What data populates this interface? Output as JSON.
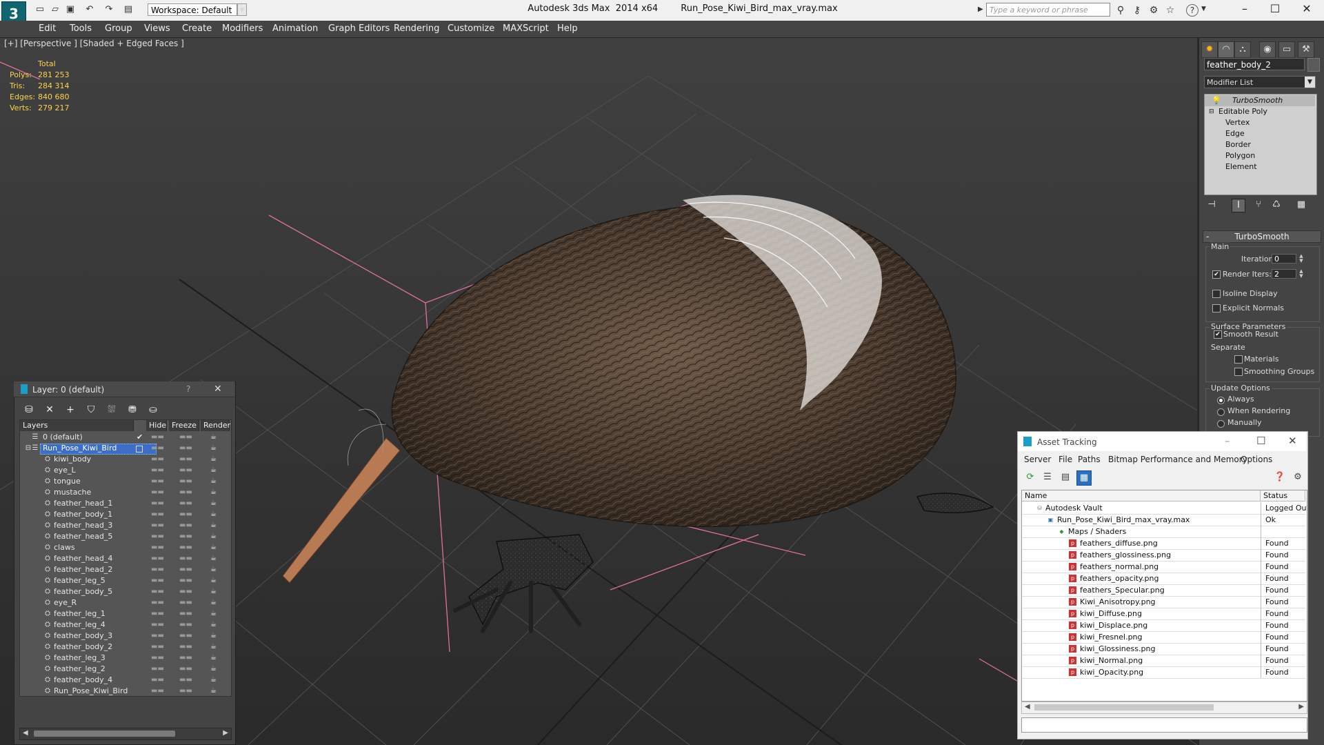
{
  "titlebar": {
    "workspace": "Workspace: Default",
    "app_name": "Autodesk 3ds Max  2014 x64",
    "file_name": "Run_Pose_Kiwi_Bird_max_vray.max",
    "search_placeholder": "Type a keyword or phrase",
    "help_label": "?",
    "minimize": "–",
    "maximize": "☐",
    "close": "✕"
  },
  "menu": [
    "Edit",
    "Tools",
    "Group",
    "Views",
    "Create",
    "Modifiers",
    "Animation",
    "Graph Editors",
    "Rendering",
    "Customize",
    "MAXScript",
    "Help"
  ],
  "viewport": {
    "label": "[+] [Perspective ] [Shaded + Edged Faces ]",
    "stats_header": "Total",
    "stats": [
      {
        "label": "Polys:",
        "value": "281 253"
      },
      {
        "label": "Tris:",
        "value": "284 314"
      },
      {
        "label": "Edges:",
        "value": "840 680"
      },
      {
        "label": "Verts:",
        "value": "279 217"
      }
    ]
  },
  "command_panel": {
    "object_name": "feather_body_2",
    "modifier_list": "Modifier List",
    "stack": {
      "turbosmooth": "TurboSmooth",
      "editable_poly": "Editable Poly",
      "subobjects": [
        "Vertex",
        "Edge",
        "Border",
        "Polygon",
        "Element"
      ]
    },
    "turbosmooth": {
      "title": "TurboSmooth",
      "main": "Main",
      "iterations_label": "Iterations:",
      "iterations_value": "0",
      "render_iters_label": "Render Iters:",
      "render_iters_value": "2",
      "isoline_display": "Isoline Display",
      "explicit_normals": "Explicit Normals",
      "surface_params": "Surface Parameters",
      "smooth_result": "Smooth Result",
      "separate": "Separate",
      "materials": "Materials",
      "smoothing_groups": "Smoothing Groups",
      "update_options": "Update Options",
      "always": "Always",
      "when_rendering": "When Rendering",
      "manually": "Manually"
    }
  },
  "layer_panel": {
    "title": "Layer: 0 (default)",
    "help": "?",
    "close": "✕",
    "columns": {
      "layers": "Layers",
      "hide": "Hide",
      "freeze": "Freeze",
      "render": "Render"
    },
    "layers": [
      "0 (default)",
      "Run_Pose_Kiwi_Bird",
      "kiwi_body",
      "eye_L",
      "tongue",
      "mustache",
      "feather_head_1",
      "feather_body_1",
      "feather_head_3",
      "feather_head_5",
      "claws",
      "feather_head_4",
      "feather_head_2",
      "feather_leg_5",
      "feather_body_5",
      "eye_R",
      "feather_leg_1",
      "feather_leg_4",
      "feather_body_3",
      "feather_body_2",
      "feather_leg_3",
      "feather_leg_2",
      "feather_body_4",
      "Run_Pose_Kiwi_Bird"
    ],
    "hide_mark": "▬▬",
    "freeze_mark": "▬▬",
    "render_mark": "☕"
  },
  "asset_tracking": {
    "title": "Asset Tracking",
    "minimize": "–",
    "maximize": "☐",
    "close": "✕",
    "menu": [
      "Server",
      "File",
      "Paths",
      "Bitmap Performance and Memory",
      "Options"
    ],
    "columns": {
      "name": "Name",
      "status": "Status"
    },
    "rows": [
      {
        "name": "Autodesk Vault",
        "status": "Logged Out"
      },
      {
        "name": "Run_Pose_Kiwi_Bird_max_vray.max",
        "status": "Ok"
      },
      {
        "name": "Maps / Shaders",
        "status": ""
      },
      {
        "name": "feathers_diffuse.png",
        "status": "Found"
      },
      {
        "name": "feathers_glossiness.png",
        "status": "Found"
      },
      {
        "name": "feathers_normal.png",
        "status": "Found"
      },
      {
        "name": "feathers_opacity.png",
        "status": "Found"
      },
      {
        "name": "feathers_Specular.png",
        "status": "Found"
      },
      {
        "name": "Kiwi_Anisotropy.png",
        "status": "Found"
      },
      {
        "name": "kiwi_Diffuse.png",
        "status": "Found"
      },
      {
        "name": "kiwi_Displace.png",
        "status": "Found"
      },
      {
        "name": "kiwi_Fresnel.png",
        "status": "Found"
      },
      {
        "name": "kiwi_Glossiness.png",
        "status": "Found"
      },
      {
        "name": "kiwi_Normal.png",
        "status": "Found"
      },
      {
        "name": "kiwi_Opacity.png",
        "status": "Found"
      }
    ]
  },
  "colors": {
    "accent": "#0f6570",
    "selection": "#3c6ec8",
    "viewport_bg": "#353535",
    "stats_yellow": "#ffd34d"
  }
}
